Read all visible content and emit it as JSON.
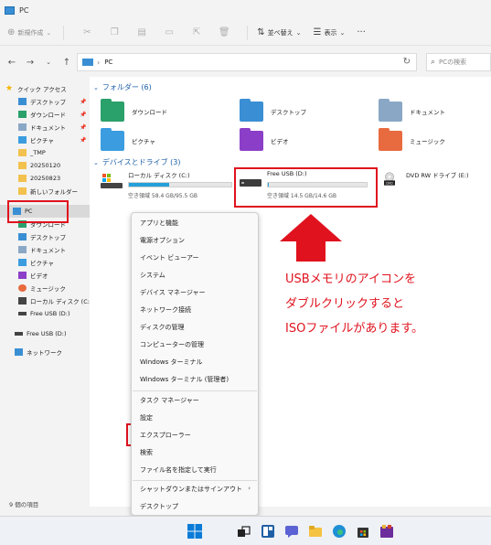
{
  "window": {
    "title": "PC"
  },
  "toolbar": {
    "new_label": "新規作成",
    "sort_label": "並べ替え",
    "view_label": "表示"
  },
  "address": {
    "path": "PC",
    "search_placeholder": "PCの検索"
  },
  "sidebar": {
    "items": [
      {
        "label": "クイック アクセス"
      },
      {
        "label": "デスクトップ"
      },
      {
        "label": "ダウンロード"
      },
      {
        "label": "ドキュメント"
      },
      {
        "label": "ピクチャ"
      },
      {
        "label": "_TMP"
      },
      {
        "label": "20250120"
      },
      {
        "label": "20250823"
      },
      {
        "label": "新しいフォルダー"
      },
      {
        "label": "PC"
      },
      {
        "label": "ダウンロード"
      },
      {
        "label": "デスクトップ"
      },
      {
        "label": "ドキュメント"
      },
      {
        "label": "ピクチャ"
      },
      {
        "label": "ビデオ"
      },
      {
        "label": "ミュージック"
      },
      {
        "label": "ローカル ディスク (C:)"
      },
      {
        "label": "Free USB (D:)"
      },
      {
        "label": "Free USB (D:)"
      },
      {
        "label": "ネットワーク"
      }
    ]
  },
  "content": {
    "folders_header": "フォルダー (6)",
    "folders": [
      {
        "label": "ダウンロード"
      },
      {
        "label": "デスクトップ"
      },
      {
        "label": "ドキュメント"
      },
      {
        "label": "ピクチャ"
      },
      {
        "label": "ビデオ"
      },
      {
        "label": "ミュージック"
      }
    ],
    "drives_header": "デバイスとドライブ (3)",
    "drives": [
      {
        "name": "ローカル ディスク (C:)",
        "free": "空き領域 58.4 GB/95.5 GB",
        "used_fraction": 0.39
      },
      {
        "name": "Free USB (D:)",
        "free": "空き領域 14.5 GB/14.6 GB",
        "used_fraction": 0.01
      },
      {
        "name": "DVD RW ドライブ (E:)"
      }
    ]
  },
  "status": {
    "count": "9 個の項目"
  },
  "context_menu": {
    "items": [
      "アプリと機能",
      "電源オプション",
      "イベント ビューアー",
      "システム",
      "デバイス マネージャー",
      "ネットワーク接続",
      "ディスクの管理",
      "コンピューターの管理",
      "Windows ターミナル",
      "Windows ターミナル (管理者)",
      "タスク マネージャー",
      "設定",
      "エクスプローラー",
      "検索",
      "ファイル名を指定して実行",
      "シャットダウンまたはサインアウト",
      "デスクトップ"
    ]
  },
  "annotation": {
    "line1": "USBメモリのアイコンを",
    "line2": "ダブルクリックすると",
    "line3": "ISOファイルがあります。",
    "color": "#e0121e"
  }
}
